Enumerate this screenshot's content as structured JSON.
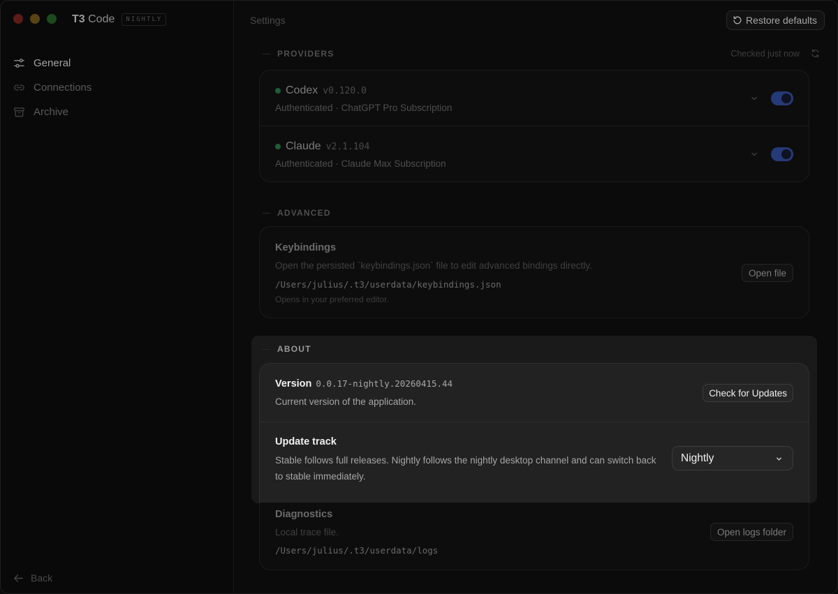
{
  "app": {
    "name_bold": "T3",
    "name_rest": " Code",
    "badge": "NIGHTLY"
  },
  "sidebar": {
    "items": [
      {
        "label": "General",
        "icon": "sliders-icon",
        "active": true
      },
      {
        "label": "Connections",
        "icon": "link-icon",
        "active": false
      },
      {
        "label": "Archive",
        "icon": "archive-icon",
        "active": false
      }
    ],
    "back_label": "Back"
  },
  "header": {
    "title": "Settings",
    "restore_label": "Restore defaults"
  },
  "providers": {
    "section_label": "PROVIDERS",
    "checked_label": "Checked just now",
    "items": [
      {
        "name": "Codex",
        "version": "v0.120.0",
        "status": "Authenticated · ChatGPT Pro Subscription",
        "enabled": true,
        "status_color": "#22c55e"
      },
      {
        "name": "Claude",
        "version": "v2.1.104",
        "status": "Authenticated · Claude Max Subscription",
        "enabled": true,
        "status_color": "#22c55e"
      }
    ]
  },
  "advanced": {
    "section_label": "ADVANCED",
    "keybindings": {
      "title": "Keybindings",
      "description": "Open the persisted `keybindings.json` file to edit advanced bindings directly.",
      "path": "/Users/julius/.t3/userdata/keybindings.json",
      "note": "Opens in your preferred editor.",
      "button": "Open file"
    }
  },
  "about": {
    "section_label": "ABOUT",
    "version": {
      "title": "Version",
      "value": "0.0.17-nightly.20260415.44",
      "description": "Current version of the application.",
      "button": "Check for Updates"
    },
    "update_track": {
      "title": "Update track",
      "description_line1": "Stable follows full releases. Nightly follows the nightly desktop channel and can switch back",
      "description_line2": "to stable immediately.",
      "selected": "Nightly"
    },
    "diagnostics": {
      "title": "Diagnostics",
      "description": "Local trace file.",
      "path": "/Users/julius/.t3/userdata/logs",
      "button": "Open logs folder"
    }
  },
  "colors": {
    "toggle_on": "#3b5bdb",
    "status_dot": "#22c55e"
  }
}
